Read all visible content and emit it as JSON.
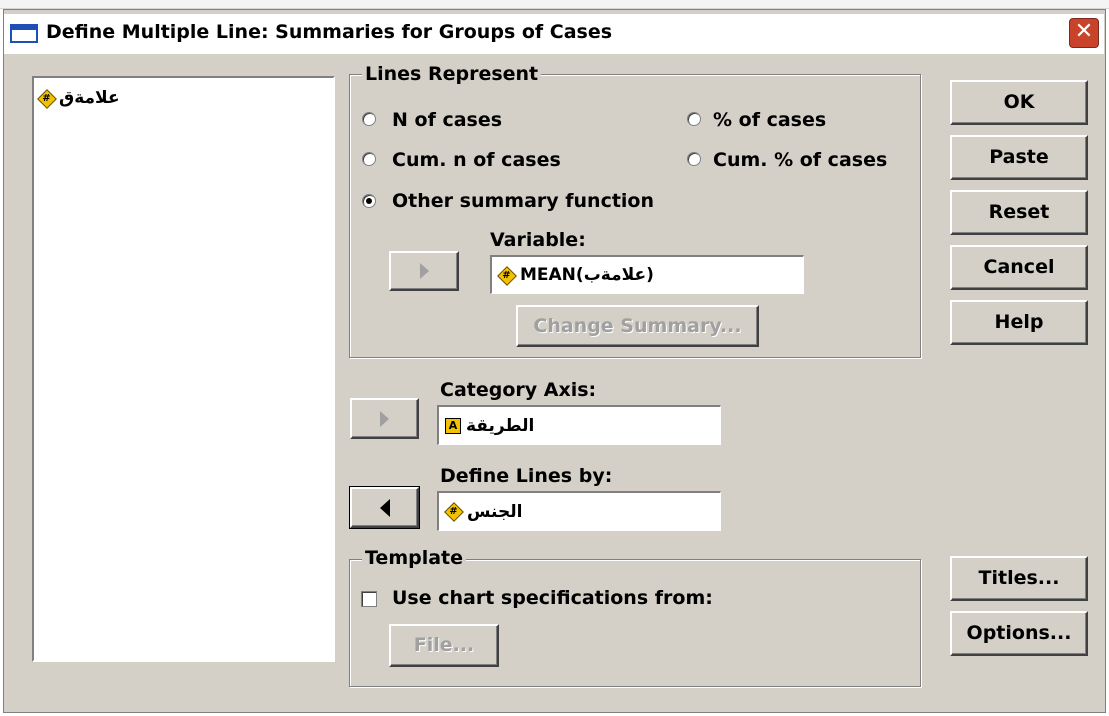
{
  "window": {
    "title": "Define Multiple Line: Summaries for Groups of Cases",
    "close_symbol": "✕"
  },
  "variable_list": {
    "items": [
      {
        "label": "علامةق",
        "icon": "scale-variable-icon",
        "icon_glyph": "#"
      }
    ]
  },
  "lines_represent": {
    "label": "Lines Represent",
    "options": [
      {
        "label": "N of cases",
        "checked": false
      },
      {
        "label": "% of cases",
        "checked": false
      },
      {
        "label": "Cum. n of cases",
        "checked": false
      },
      {
        "label": "Cum. % of cases",
        "checked": false
      },
      {
        "label": "Other summary function",
        "checked": true
      }
    ],
    "variable_label": "Variable:",
    "variable_value": "MEAN(علامةب)",
    "variable_icon_glyph": "#",
    "change_summary_label": "Change Summary..."
  },
  "category_axis": {
    "label": "Category Axis:",
    "value": "الطريقة",
    "icon_glyph": "A"
  },
  "define_lines": {
    "label": "Define Lines by:",
    "value": "الجنس",
    "icon_glyph": "#"
  },
  "template": {
    "label": "Template",
    "checkbox_label": "Use chart specifications from:",
    "checked": false,
    "file_label": "File..."
  },
  "buttons": {
    "ok": "OK",
    "paste": "Paste",
    "reset": "Reset",
    "cancel": "Cancel",
    "help": "Help",
    "titles": "Titles...",
    "options": "Options..."
  },
  "colors": {
    "dialog_bg": "#d4d0c8",
    "title_icon_blue": "#1e4fb8",
    "close_red": "#c9432a",
    "scale_icon_yellow": "#f2c200"
  }
}
